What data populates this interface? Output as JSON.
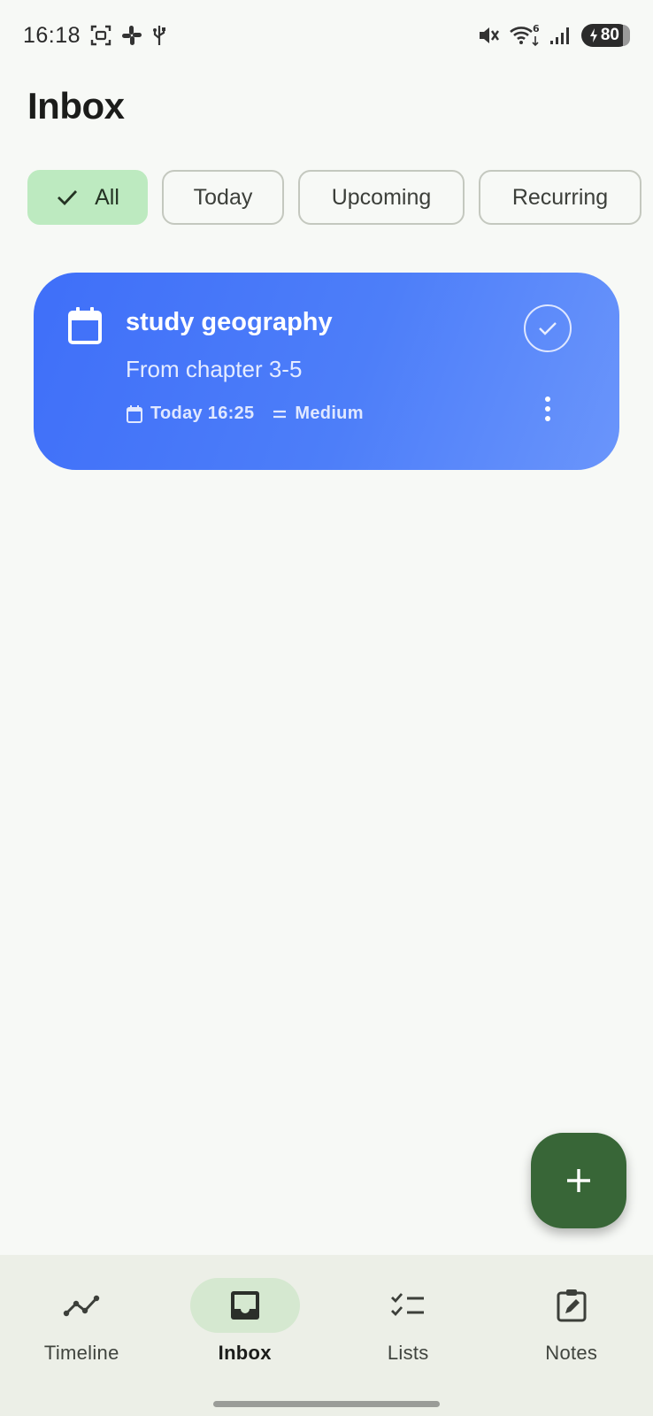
{
  "status_bar": {
    "time": "16:18",
    "left_icons": [
      "screenshot-icon",
      "slack-icon",
      "usb-icon"
    ],
    "right_icons": [
      "mute-icon",
      "wifi-icon",
      "signal-icon"
    ],
    "wifi_badge": "6",
    "battery_level": "80"
  },
  "page": {
    "title": "Inbox"
  },
  "filters": [
    {
      "label": "All",
      "selected": true
    },
    {
      "label": "Today",
      "selected": false
    },
    {
      "label": "Upcoming",
      "selected": false
    },
    {
      "label": "Recurring",
      "selected": false
    }
  ],
  "task": {
    "title": "study geography",
    "description": "From chapter 3-5",
    "due": "Today 16:25",
    "priority": "Medium",
    "color": "#4d7ef9"
  },
  "fab": {
    "icon": "plus-icon",
    "color": "#386637"
  },
  "nav": [
    {
      "label": "Timeline",
      "icon": "timeline-icon",
      "active": false
    },
    {
      "label": "Inbox",
      "icon": "inbox-icon",
      "active": true
    },
    {
      "label": "Lists",
      "icon": "checklist-icon",
      "active": false
    },
    {
      "label": "Notes",
      "icon": "note-edit-icon",
      "active": false
    }
  ]
}
